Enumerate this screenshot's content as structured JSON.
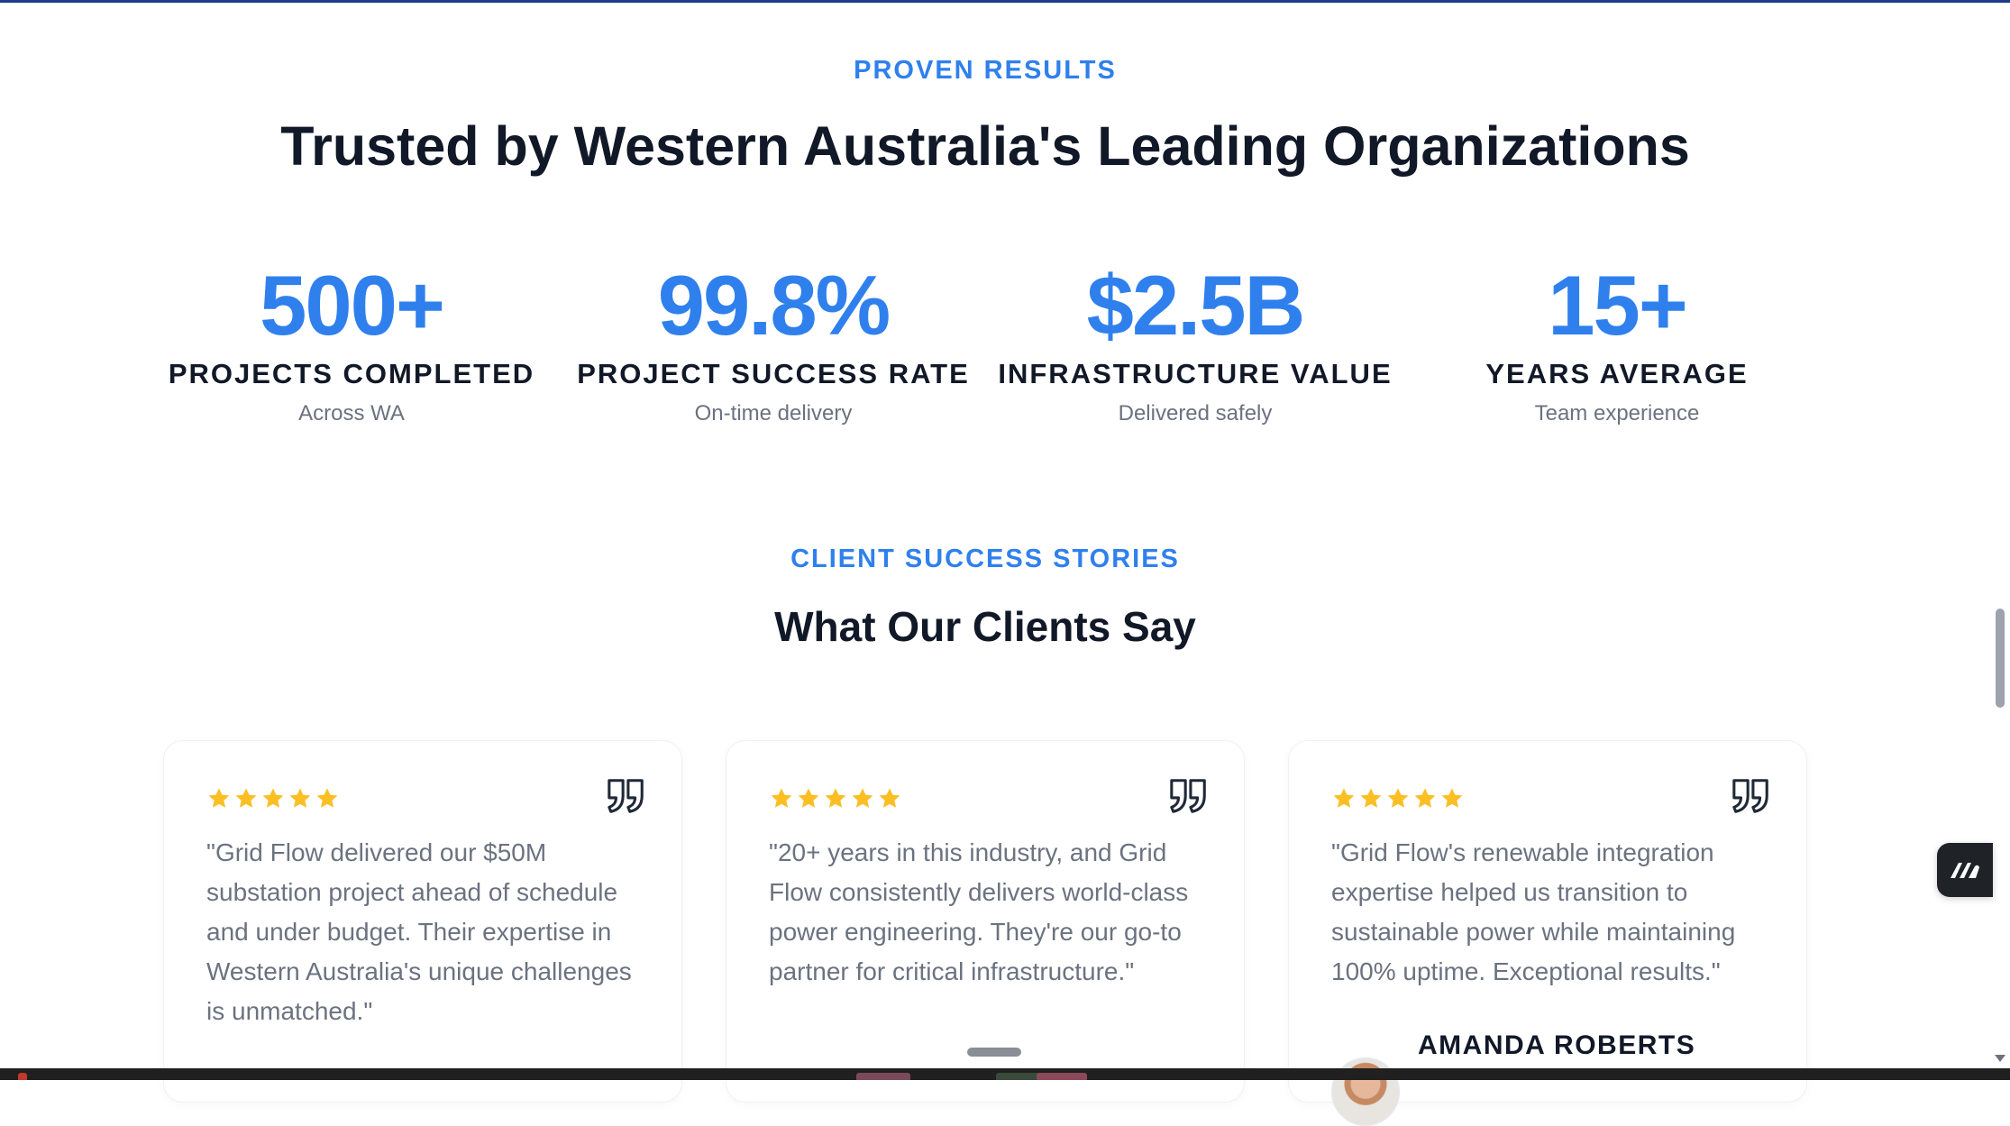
{
  "results": {
    "eyebrow": "PROVEN RESULTS",
    "title": "Trusted by Western Australia's Leading Organizations",
    "stats": [
      {
        "value": "500+",
        "label": "PROJECTS COMPLETED",
        "sub": "Across WA"
      },
      {
        "value": "99.8%",
        "label": "PROJECT SUCCESS RATE",
        "sub": "On-time delivery"
      },
      {
        "value": "$2.5B",
        "label": "INFRASTRUCTURE VALUE",
        "sub": "Delivered safely"
      },
      {
        "value": "15+",
        "label": "YEARS AVERAGE",
        "sub": "Team experience"
      }
    ]
  },
  "testimonials": {
    "eyebrow": "CLIENT SUCCESS STORIES",
    "title": "What Our Clients Say",
    "cards": [
      {
        "rating": 5,
        "quote": "\"Grid Flow delivered our $50M substation project ahead of schedule and under budget. Their expertise in Western Australia's unique challenges is unmatched.\"",
        "author": ""
      },
      {
        "rating": 5,
        "quote": "\"20+ years in this industry, and Grid Flow consistently delivers world-class power engineering. They're our go-to partner for critical infrastructure.\"",
        "author": ""
      },
      {
        "rating": 5,
        "quote": "\"Grid Flow's renewable integration expertise helped us transition to sustainable power while maintaining 100% uptime. Exceptional results.\"",
        "author": "AMANDA ROBERTS"
      }
    ]
  },
  "colors": {
    "accent": "#2f80ed",
    "star": "#fbbf24",
    "heading": "#111827",
    "muted": "#6b7280"
  },
  "icons": {
    "star": "star-icon",
    "quote": "quote-icon",
    "widget": "chat-widget-logo-icon"
  }
}
